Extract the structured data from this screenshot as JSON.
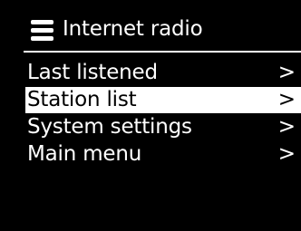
{
  "colors": {
    "background": "#000000",
    "foreground": "#ffffff",
    "selected_background": "#ffffff",
    "selected_text": "#000000"
  },
  "header": {
    "icon": "menu-icon",
    "title": "Internet radio"
  },
  "menu": {
    "items": [
      {
        "label": "Last listened",
        "arrow": ">",
        "selected": false
      },
      {
        "label": "Station list",
        "arrow": ">",
        "selected": true
      },
      {
        "label": "System settings",
        "arrow": ">",
        "selected": false
      },
      {
        "label": "Main menu",
        "arrow": ">",
        "selected": false
      }
    ]
  }
}
